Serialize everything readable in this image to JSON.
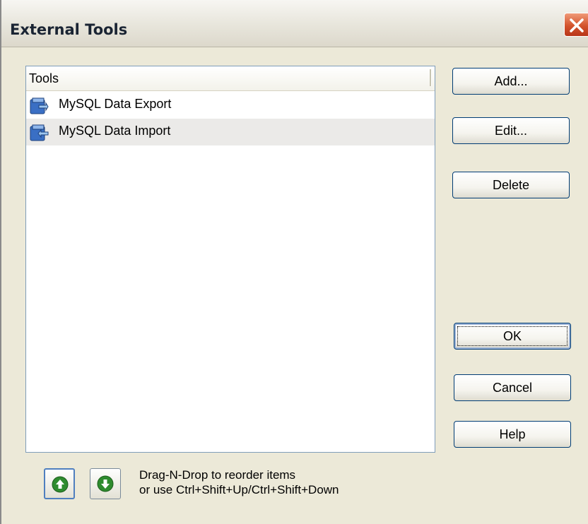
{
  "window": {
    "title": "External Tools"
  },
  "list": {
    "header": "Tools",
    "items": [
      {
        "label": "MySQL Data Export",
        "icon": "export-tool-icon",
        "selected": false
      },
      {
        "label": "MySQL Data Import",
        "icon": "import-tool-icon",
        "selected": true
      }
    ]
  },
  "buttons": {
    "add": "Add...",
    "edit": "Edit...",
    "delete": "Delete",
    "ok": "OK",
    "cancel": "Cancel",
    "help": "Help"
  },
  "reorder": {
    "up_icon": "arrow-up-circle-icon",
    "down_icon": "arrow-down-circle-icon",
    "hint_line1": "Drag-N-Drop to reorder items",
    "hint_line2": "or use Ctrl+Shift+Up/Ctrl+Shift+Down"
  },
  "colors": {
    "title_close": "#d3532c",
    "arrow_green": "#2e8b2e",
    "button_border": "#003c74"
  }
}
